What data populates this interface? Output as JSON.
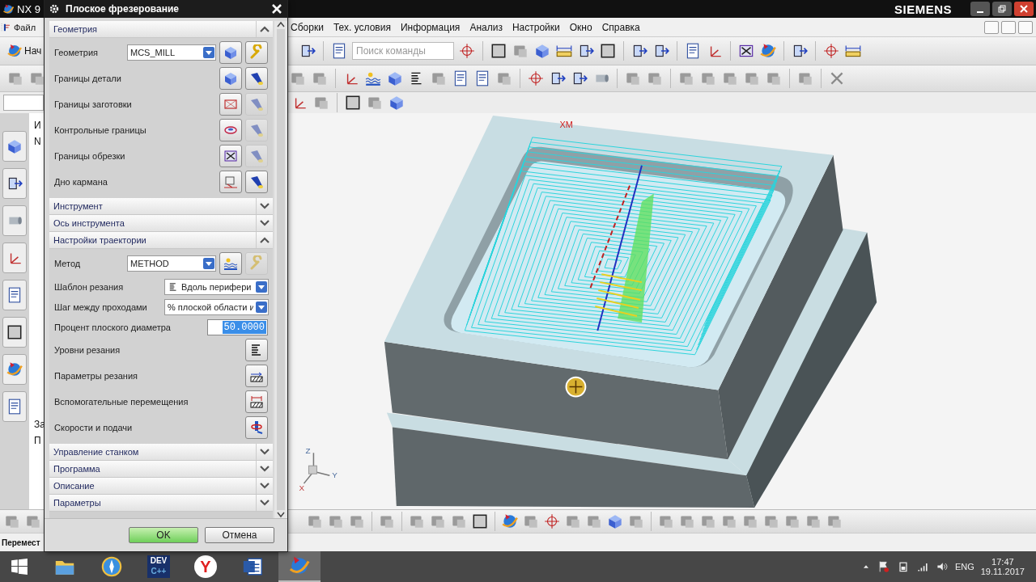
{
  "app": {
    "logo_text": "NX 9",
    "brand": "SIEMENS"
  },
  "menu": [
    {
      "label": "Файл"
    },
    {
      "label": "Сборки"
    },
    {
      "label": "Тех. условия"
    },
    {
      "label": "Информация"
    },
    {
      "label": "Анализ"
    },
    {
      "label": "Настройки"
    },
    {
      "label": "Окно"
    },
    {
      "label": "Справка"
    }
  ],
  "toolbar": {
    "home_label": "Нач",
    "search": {
      "placeholder": "Поиск команды"
    }
  },
  "navigator": {
    "column_1": "И",
    "cell_1": "N",
    "panel_1": "За",
    "panel_2": "П"
  },
  "viewport": {
    "mcs_label": "XM",
    "axes": [
      "Z",
      "Y",
      "X"
    ]
  },
  "status_bar": {
    "text": "Перемест"
  },
  "dialog": {
    "title": "Плоское фрезерование",
    "ok": "OK",
    "cancel": "Отмена",
    "sections": [
      {
        "title": "Геометрия",
        "expanded": true,
        "rows": [
          {
            "kind": "select",
            "label": "Геометрия",
            "value": "MCS_MILL",
            "buttons": [
              {
                "disabled": false
              },
              {
                "disabled": false
              }
            ]
          },
          {
            "kind": "buttons",
            "label": "Границы детали",
            "buttons": [
              {
                "disabled": false
              },
              {
                "disabled": false
              }
            ]
          },
          {
            "kind": "buttons",
            "label": "Границы заготовки",
            "buttons": [
              {
                "disabled": false
              },
              {
                "disabled": true
              }
            ]
          },
          {
            "kind": "buttons",
            "label": "Контрольные границы",
            "buttons": [
              {
                "disabled": false
              },
              {
                "disabled": true
              }
            ]
          },
          {
            "kind": "buttons",
            "label": "Границы обрезки",
            "buttons": [
              {
                "disabled": false
              },
              {
                "disabled": true
              }
            ]
          },
          {
            "kind": "buttons",
            "label": "Дно кармана",
            "buttons": [
              {
                "disabled": false
              },
              {
                "disabled": false
              }
            ]
          }
        ]
      },
      {
        "title": "Инструмент",
        "expanded": false
      },
      {
        "title": "Ось инструмента",
        "expanded": false
      },
      {
        "title": "Настройки траектории",
        "expanded": true,
        "rows": [
          {
            "kind": "select",
            "label": "Метод",
            "value": "METHOD",
            "buttons": [
              {
                "disabled": false
              },
              {
                "disabled": true
              }
            ]
          },
          {
            "kind": "pattern_select",
            "label": "Шаблон резания",
            "value": "Вдоль перифери"
          },
          {
            "kind": "wide_select",
            "label": "Шаг между проходами",
            "value": "% плоской области и"
          },
          {
            "kind": "number",
            "label": "Процент плоского диаметра",
            "value": "50.0000",
            "selected": true
          },
          {
            "kind": "buttons",
            "label": "Уровни резания",
            "buttons": [
              {
                "disabled": false
              }
            ]
          },
          {
            "kind": "buttons",
            "label": "Параметры резания",
            "buttons": [
              {
                "disabled": false
              }
            ]
          },
          {
            "kind": "buttons",
            "label": "Вспомогательные перемещения",
            "buttons": [
              {
                "disabled": false
              }
            ]
          },
          {
            "kind": "buttons",
            "label": "Скорости и подачи",
            "buttons": [
              {
                "disabled": false
              }
            ]
          }
        ]
      },
      {
        "title": "Управление станком",
        "expanded": false
      },
      {
        "title": "Программа",
        "expanded": false
      },
      {
        "title": "Описание",
        "expanded": false
      },
      {
        "title": "Параметры",
        "expanded": false
      }
    ]
  },
  "taskbar": {
    "apps": [
      {
        "kind": "folder",
        "active": false
      },
      {
        "kind": "compass",
        "active": false
      },
      {
        "kind": "devcpp",
        "label": "DEV",
        "sublabel": "C++",
        "active": false
      },
      {
        "kind": "yandex",
        "label": "Y",
        "active": false
      },
      {
        "kind": "word",
        "active": false
      },
      {
        "kind": "nx",
        "active": true
      }
    ],
    "tray": {
      "language": "ENG",
      "time": "17:47",
      "date": "19.11.2017"
    }
  }
}
